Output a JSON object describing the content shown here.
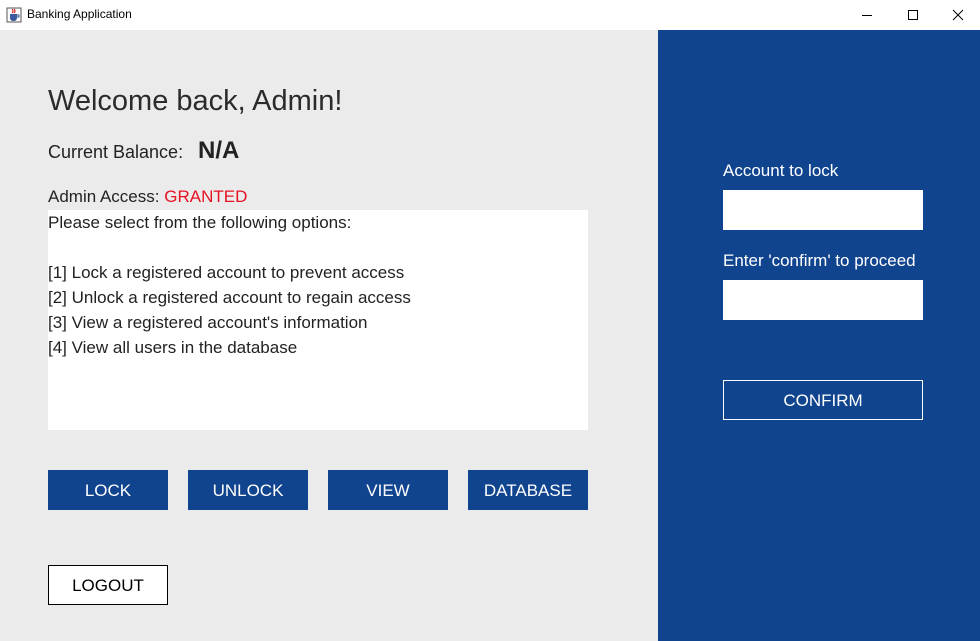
{
  "window": {
    "title": "Banking Application",
    "app_icon": "java-coffee-icon",
    "controls": {
      "minimize_icon": "minimize-icon",
      "maximize_icon": "maximize-icon",
      "close_icon": "close-icon"
    }
  },
  "main": {
    "welcome": "Welcome back, Admin!",
    "balance_label": "Current Balance:",
    "balance_value": "N/A",
    "admin_label": "Admin Access:",
    "admin_status": "GRANTED",
    "options": [
      "Please select from the following options:",
      "",
      "[1] Lock a registered account to prevent access",
      "[2] Unlock a registered account to regain access",
      "[3] View a registered account's information",
      "[4] View all users in the database"
    ],
    "buttons": {
      "lock": "LOCK",
      "unlock": "UNLOCK",
      "view": "VIEW",
      "database": "DATABASE",
      "logout": "LOGOUT"
    }
  },
  "side": {
    "account_label": "Account to lock",
    "account_value": "",
    "confirm_label": "Enter 'confirm' to proceed",
    "confirm_value": "",
    "confirm_button": "CONFIRM"
  },
  "colors": {
    "primary_blue": "#11448e",
    "panel_gray": "#ebebeb",
    "granted_red": "#e81123"
  }
}
